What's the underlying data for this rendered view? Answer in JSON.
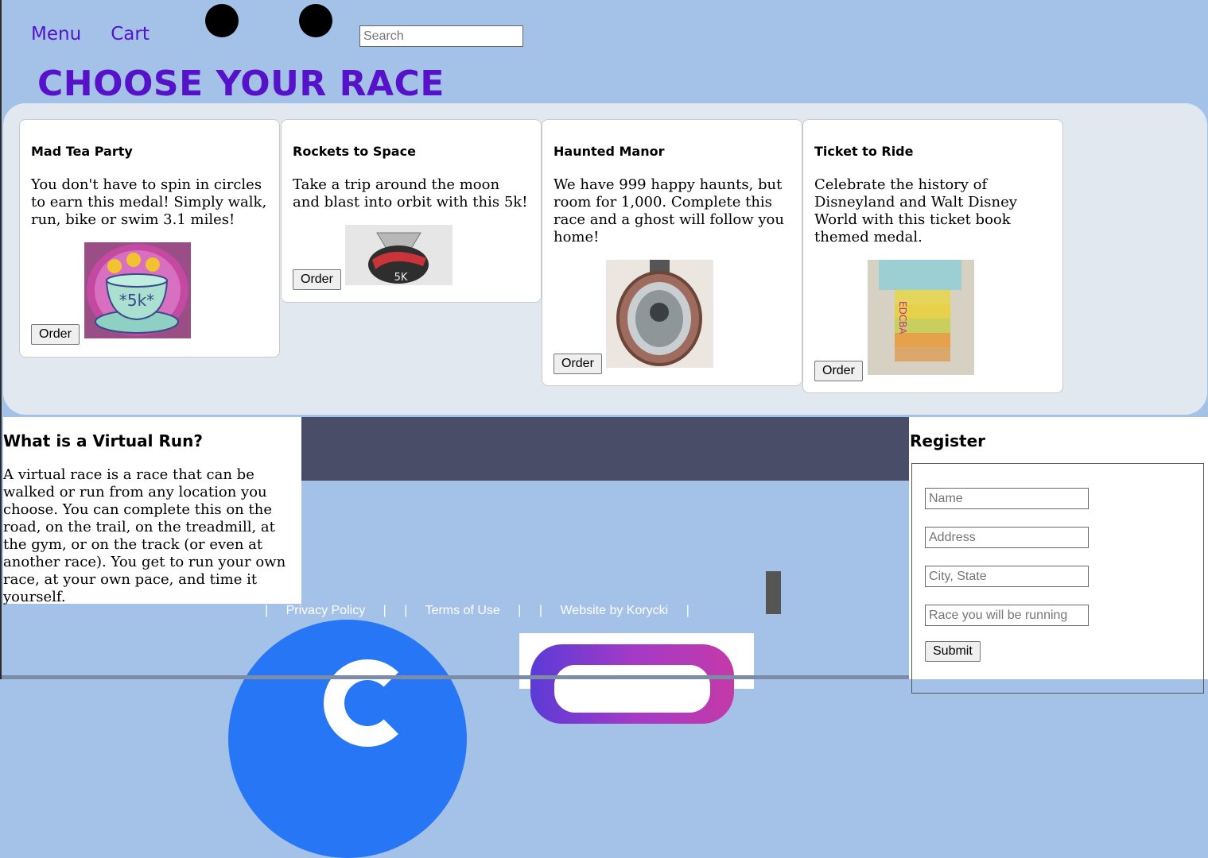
{
  "nav": {
    "menu": "Menu",
    "cart": "Cart"
  },
  "search": {
    "placeholder": "Search"
  },
  "page_title": "CHOOSE YOUR RACE",
  "races": [
    {
      "title": "Mad Tea Party",
      "desc": "You don't have to spin in circles to earn this medal! Simply walk, run, bike or swim 3.1 miles!",
      "button": "Order",
      "medal_text": "*5k*"
    },
    {
      "title": "Rockets to Space",
      "desc": "Take a trip around the moon and blast into orbit with this 5k!",
      "button": "Order",
      "medal_text": "5K"
    },
    {
      "title": "Haunted Manor",
      "desc": "We have 999 happy haunts, but room for 1,000. Complete this race and a ghost will follow you home!",
      "button": "Order"
    },
    {
      "title": "Ticket to Ride",
      "desc": "Celebrate the history of Disneyland and Walt Disney World with this ticket book themed medal.",
      "button": "Order",
      "medal_text": "EDCBA"
    }
  ],
  "virtual": {
    "heading": "What is a Virtual Run?",
    "body": "A virtual race is a race that can be walked or run from any location you choose. You can complete this on the road, on the trail, on the treadmill, at the gym, or on the track (or even at another race). You get to run your own race, at your own pace, and time it yourself."
  },
  "footer": {
    "sep": "|",
    "privacy": "Privacy Policy",
    "terms": "Terms of Use",
    "credit": "Website by Korycki"
  },
  "register": {
    "heading": "Register",
    "name_placeholder": "Name",
    "address_placeholder": "Address",
    "city_placeholder": "City, State",
    "race_placeholder": "Race you will be running",
    "submit": "Submit"
  },
  "colors": {
    "brand": "#5512c9",
    "background": "#a4c2e8",
    "panel": "#e1e8f0",
    "band": "#4a4d67"
  }
}
